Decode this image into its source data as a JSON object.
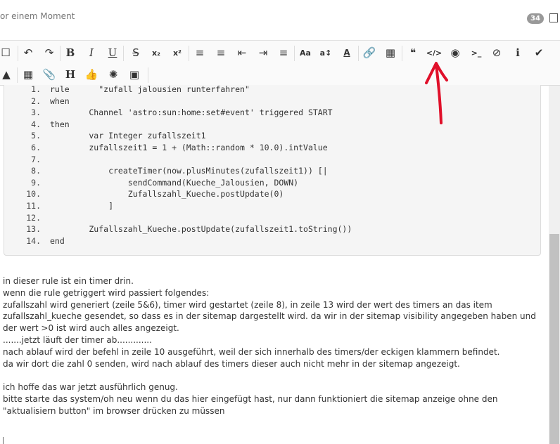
{
  "header": {
    "timestamp": "or einem Moment",
    "count": "34"
  },
  "toolbar": {
    "row1": [
      {
        "name": "checkbox-icon",
        "glyph": "☐"
      },
      {
        "name": "undo-icon",
        "glyph": "↶"
      },
      {
        "name": "redo-icon",
        "glyph": "↷"
      },
      {
        "name": "bold-button",
        "glyph": "B"
      },
      {
        "name": "italic-button",
        "glyph": "I"
      },
      {
        "name": "underline-button",
        "glyph": "U"
      },
      {
        "name": "strikethrough-button",
        "glyph": "S"
      },
      {
        "name": "subscript-button",
        "glyph": "x₂"
      },
      {
        "name": "superscript-button",
        "glyph": "x²"
      },
      {
        "name": "ordered-list-icon",
        "glyph": "≡"
      },
      {
        "name": "bullet-list-icon",
        "glyph": "≡"
      },
      {
        "name": "outdent-icon",
        "glyph": "⇤"
      },
      {
        "name": "indent-icon",
        "glyph": "⇥"
      },
      {
        "name": "align-icon",
        "glyph": "≡"
      },
      {
        "name": "font-size-icon",
        "glyph": "Aa"
      },
      {
        "name": "line-height-icon",
        "glyph": "a↕"
      },
      {
        "name": "text-color-icon",
        "glyph": "A"
      },
      {
        "name": "link-icon",
        "glyph": "🔗"
      },
      {
        "name": "table-icon",
        "glyph": "▦"
      },
      {
        "name": "quote-icon",
        "glyph": "❝"
      },
      {
        "name": "code-icon",
        "glyph": "</>"
      },
      {
        "name": "spoiler-eye-icon",
        "glyph": "◉"
      },
      {
        "name": "terminal-icon",
        "glyph": ">_"
      },
      {
        "name": "remove-format-icon",
        "glyph": "⊘"
      },
      {
        "name": "info-icon",
        "glyph": "ℹ"
      },
      {
        "name": "check-icon",
        "glyph": "✔"
      }
    ],
    "row2": [
      {
        "name": "warning-icon",
        "glyph": "▲"
      },
      {
        "name": "grid-icon",
        "glyph": "▦"
      },
      {
        "name": "attachment-icon",
        "glyph": "📎"
      },
      {
        "name": "heading-button",
        "glyph": "H"
      },
      {
        "name": "thumbs-up-icon",
        "glyph": "👍"
      },
      {
        "name": "rebel-icon",
        "glyph": "✺"
      },
      {
        "name": "image-icon",
        "glyph": "▣"
      }
    ]
  },
  "code": {
    "lines": [
      {
        "n": "1.",
        "text": "rule      \"zufall jalousien runterfahren\""
      },
      {
        "n": "2.",
        "text": "when"
      },
      {
        "n": "3.",
        "text": "        Channel 'astro:sun:home:set#event' triggered START"
      },
      {
        "n": "4.",
        "text": "then"
      },
      {
        "n": "5.",
        "text": "        var Integer zufallszeit1"
      },
      {
        "n": "6.",
        "text": "        zufallszeit1 = 1 + (Math::random * 10.0).intValue"
      },
      {
        "n": "7.",
        "text": ""
      },
      {
        "n": "8.",
        "text": "            createTimer(now.plusMinutes(zufallszeit1)) [|"
      },
      {
        "n": "9.",
        "text": "                sendCommand(Kueche_Jalousien, DOWN)"
      },
      {
        "n": "10.",
        "text": "                Zufallszahl_Kueche.postUpdate(0)"
      },
      {
        "n": "11.",
        "text": "            ]"
      },
      {
        "n": "12.",
        "text": ""
      },
      {
        "n": "13.",
        "text": "        Zufallszahl_Kueche.postUpdate(zufallszeit1.toString())"
      },
      {
        "n": "14.",
        "text": "end"
      }
    ]
  },
  "prose": {
    "p1": "in dieser rule ist ein timer drin.",
    "p2": "wenn die rule getriggert wird passiert folgendes:",
    "p3": "zufallszahl wird generiert (zeile 5&6), timer wird gestartet (zeile 8), in zeile 13 wird der wert des timers an das item zufallszahl_kueche gesendet, so dass es in der sitemap dargestellt wird. da wir in der sitemap visibility angegeben haben und der wert >0 ist wird auch alles angezeigt.",
    "p4": ".......jetzt läuft der timer ab.............",
    "p5": "nach ablauf wird der befehl in zeile 10 ausgeführt, weil der sich innerhalb des timers/der eckigen klammern befindet.",
    "p6": "da wir dort die zahl 0 senden, wird nach ablauf des timers dieser auch nicht mehr in der sitemap angezeigt.",
    "p7": "ich hoffe das war jetzt ausführlich genug.",
    "p8": "bitte starte das system/oh neu wenn du das hier eingefügt hast, nur dann funktioniert die sitemap anzeige ohne den \"aktualisiern button\" im browser drücken zu müssen"
  },
  "colors": {
    "annotation_arrow": "#e0102a",
    "badge": "#999999",
    "code_bg": "#f5f5f5"
  }
}
